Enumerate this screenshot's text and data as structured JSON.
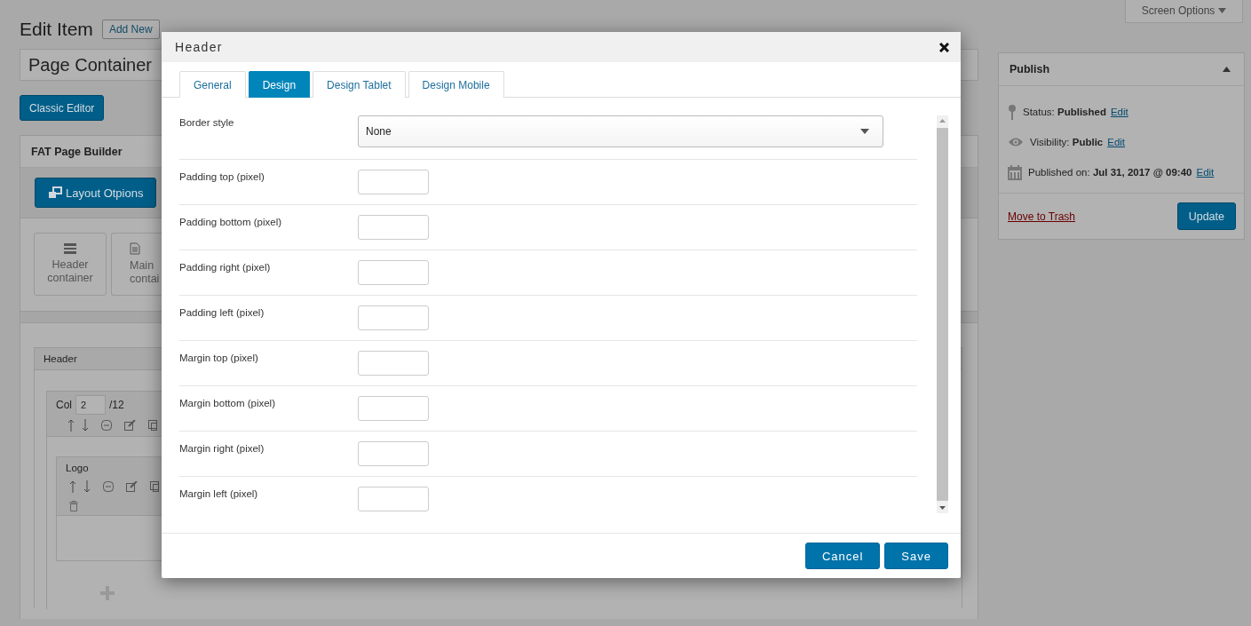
{
  "screen_options": {
    "label": "Screen Options"
  },
  "page": {
    "title": "Edit Item",
    "add_new": "Add New",
    "title_field": {
      "value": "Page Container"
    },
    "classic_editor": "Classic Editor"
  },
  "builder": {
    "title": "FAT Page Builder",
    "layout_button": "Layout Otpions",
    "element_cards": [
      {
        "kind": "header",
        "label": "Header container"
      },
      {
        "kind": "main",
        "label": "Main contai"
      }
    ],
    "section": {
      "title": "Header",
      "column": {
        "label": "Col",
        "value": "2",
        "total": "/12"
      },
      "element": {
        "title": "Logo"
      }
    }
  },
  "publish": {
    "title": "Publish",
    "items": [
      {
        "kind": "status",
        "label": "Status:",
        "value": "Published",
        "link": "Edit"
      },
      {
        "kind": "visibility",
        "label": "Visibility:",
        "value": "Public",
        "link": "Edit"
      },
      {
        "kind": "date",
        "label": "Published on:",
        "value": "Jul 31, 2017 @ 09:40",
        "link": "Edit"
      }
    ],
    "trash": "Move to Trash",
    "update": "Update"
  },
  "modal": {
    "title": "Header",
    "tabs": [
      {
        "label": "General",
        "selected": false
      },
      {
        "label": "Design",
        "selected": true
      },
      {
        "label": "Design Tablet",
        "selected": false
      },
      {
        "label": "Design Mobile",
        "selected": false
      }
    ],
    "fields": [
      {
        "kind": "select",
        "label": "Border style",
        "value": "None"
      },
      {
        "kind": "number",
        "label": "Padding top (pixel)"
      },
      {
        "kind": "number",
        "label": "Padding bottom (pixel)"
      },
      {
        "kind": "number",
        "label": "Padding right (pixel)"
      },
      {
        "kind": "number",
        "label": "Padding left (pixel)"
      },
      {
        "kind": "number",
        "label": "Margin top (pixel)"
      },
      {
        "kind": "number",
        "label": "Margin bottom (pixel)"
      },
      {
        "kind": "number",
        "label": "Margin right (pixel)"
      },
      {
        "kind": "number",
        "label": "Margin left (pixel)"
      }
    ],
    "buttons": [
      {
        "label": "Cancel"
      },
      {
        "label": "Save"
      }
    ]
  }
}
